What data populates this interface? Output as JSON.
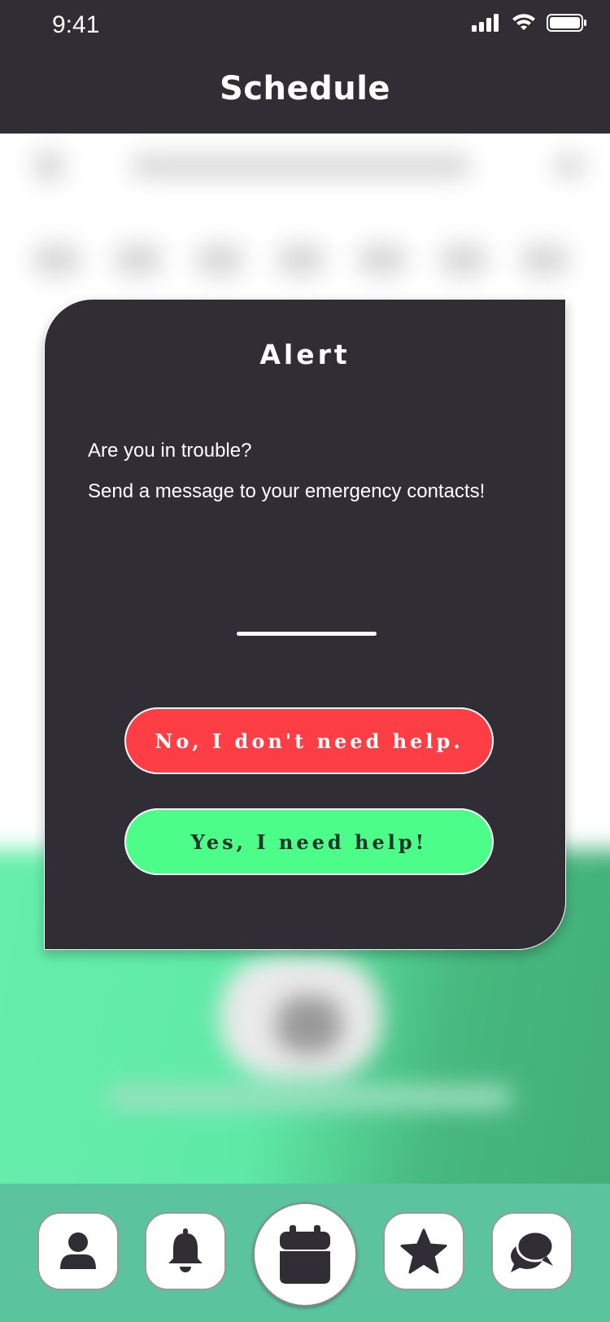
{
  "status_bar": {
    "time": "9:41"
  },
  "header": {
    "title": "Schedule"
  },
  "alert": {
    "title": "Alert",
    "line1": "Are you in trouble?",
    "line2": "Send a message to your emergency contacts!",
    "no_button": "No, I don't need help.",
    "yes_button": "Yes, I need help!"
  },
  "bottom_nav": {
    "items": [
      {
        "icon": "profile-icon"
      },
      {
        "icon": "bell-icon"
      },
      {
        "icon": "calendar-icon",
        "active": true
      },
      {
        "icon": "star-icon"
      },
      {
        "icon": "chat-icon"
      }
    ]
  },
  "colors": {
    "header_bg": "#302d34",
    "alert_bg": "#302d34",
    "no_button": "#fd3f45",
    "yes_button": "#4cfd89",
    "nav_bg": "#5cc39f"
  }
}
